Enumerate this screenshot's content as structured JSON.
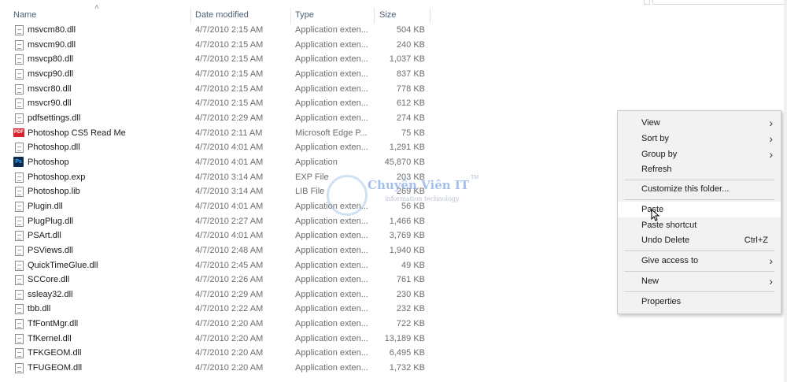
{
  "columns": {
    "name": "Name",
    "date": "Date modified",
    "type": "Type",
    "size": "Size"
  },
  "files": [
    {
      "name": "msvcm80.dll",
      "date": "4/7/2010 2:15 AM",
      "type": "Application exten...",
      "size": "504 KB",
      "icon": "dll-file-icon"
    },
    {
      "name": "msvcm90.dll",
      "date": "4/7/2010 2:15 AM",
      "type": "Application exten...",
      "size": "240 KB",
      "icon": "dll-file-icon"
    },
    {
      "name": "msvcp80.dll",
      "date": "4/7/2010 2:15 AM",
      "type": "Application exten...",
      "size": "1,037 KB",
      "icon": "dll-file-icon"
    },
    {
      "name": "msvcp90.dll",
      "date": "4/7/2010 2:15 AM",
      "type": "Application exten...",
      "size": "837 KB",
      "icon": "dll-file-icon"
    },
    {
      "name": "msvcr80.dll",
      "date": "4/7/2010 2:15 AM",
      "type": "Application exten...",
      "size": "778 KB",
      "icon": "dll-file-icon"
    },
    {
      "name": "msvcr90.dll",
      "date": "4/7/2010 2:15 AM",
      "type": "Application exten...",
      "size": "612 KB",
      "icon": "dll-file-icon"
    },
    {
      "name": "pdfsettings.dll",
      "date": "4/7/2010 2:29 AM",
      "type": "Application exten...",
      "size": "274 KB",
      "icon": "dll-file-icon"
    },
    {
      "name": "Photoshop CS5 Read Me",
      "date": "4/7/2010 2:11 AM",
      "type": "Microsoft Edge P...",
      "size": "75 KB",
      "icon": "pdf-icon"
    },
    {
      "name": "Photoshop.dll",
      "date": "4/7/2010 4:01 AM",
      "type": "Application exten...",
      "size": "1,291 KB",
      "icon": "dll-file-icon"
    },
    {
      "name": "Photoshop",
      "date": "4/7/2010 4:01 AM",
      "type": "Application",
      "size": "45,870 KB",
      "icon": "photoshop-icon"
    },
    {
      "name": "Photoshop.exp",
      "date": "4/7/2010 3:14 AM",
      "type": "EXP File",
      "size": "203 KB",
      "icon": "blank-file-icon"
    },
    {
      "name": "Photoshop.lib",
      "date": "4/7/2010 3:14 AM",
      "type": "LIB File",
      "size": "269 KB",
      "icon": "blank-file-icon"
    },
    {
      "name": "Plugin.dll",
      "date": "4/7/2010 4:01 AM",
      "type": "Application exten...",
      "size": "56 KB",
      "icon": "dll-file-icon"
    },
    {
      "name": "PlugPlug.dll",
      "date": "4/7/2010 2:27 AM",
      "type": "Application exten...",
      "size": "1,466 KB",
      "icon": "dll-file-icon"
    },
    {
      "name": "PSArt.dll",
      "date": "4/7/2010 4:01 AM",
      "type": "Application exten...",
      "size": "3,769 KB",
      "icon": "dll-file-icon"
    },
    {
      "name": "PSViews.dll",
      "date": "4/7/2010 2:48 AM",
      "type": "Application exten...",
      "size": "1,940 KB",
      "icon": "dll-file-icon"
    },
    {
      "name": "QuickTimeGlue.dll",
      "date": "4/7/2010 2:45 AM",
      "type": "Application exten...",
      "size": "49 KB",
      "icon": "dll-file-icon"
    },
    {
      "name": "SCCore.dll",
      "date": "4/7/2010 2:26 AM",
      "type": "Application exten...",
      "size": "761 KB",
      "icon": "dll-file-icon"
    },
    {
      "name": "ssleay32.dll",
      "date": "4/7/2010 2:29 AM",
      "type": "Application exten...",
      "size": "230 KB",
      "icon": "dll-file-icon"
    },
    {
      "name": "tbb.dll",
      "date": "4/7/2010 2:22 AM",
      "type": "Application exten...",
      "size": "232 KB",
      "icon": "dll-file-icon"
    },
    {
      "name": "TfFontMgr.dll",
      "date": "4/7/2010 2:20 AM",
      "type": "Application exten...",
      "size": "722 KB",
      "icon": "dll-file-icon"
    },
    {
      "name": "TfKernel.dll",
      "date": "4/7/2010 2:20 AM",
      "type": "Application exten...",
      "size": "13,189 KB",
      "icon": "dll-file-icon"
    },
    {
      "name": "TFKGEOM.dll",
      "date": "4/7/2010 2:20 AM",
      "type": "Application exten...",
      "size": "6,495 KB",
      "icon": "dll-file-icon"
    },
    {
      "name": "TFUGEOM.dll",
      "date": "4/7/2010 2:20 AM",
      "type": "Application exten...",
      "size": "1,732 KB",
      "icon": "dll-file-icon"
    }
  ],
  "watermark": {
    "title": "Chuyên Viên IT",
    "subtitle": "information technology",
    "tm": "TM"
  },
  "context_menu": {
    "view": "View",
    "sort_by": "Sort by",
    "group_by": "Group by",
    "refresh": "Refresh",
    "customize": "Customize this folder...",
    "paste": "Paste",
    "paste_shortcut": "Paste shortcut",
    "undo_delete": "Undo Delete",
    "undo_shortcut": "Ctrl+Z",
    "give_access": "Give access to",
    "new": "New",
    "properties": "Properties",
    "highlighted": "Paste"
  },
  "colors": {
    "header_text": "#4c607a",
    "menu_bg": "#f2f2f2",
    "pdf_red": "#d8232a",
    "ps_blue": "#31a8ff"
  }
}
